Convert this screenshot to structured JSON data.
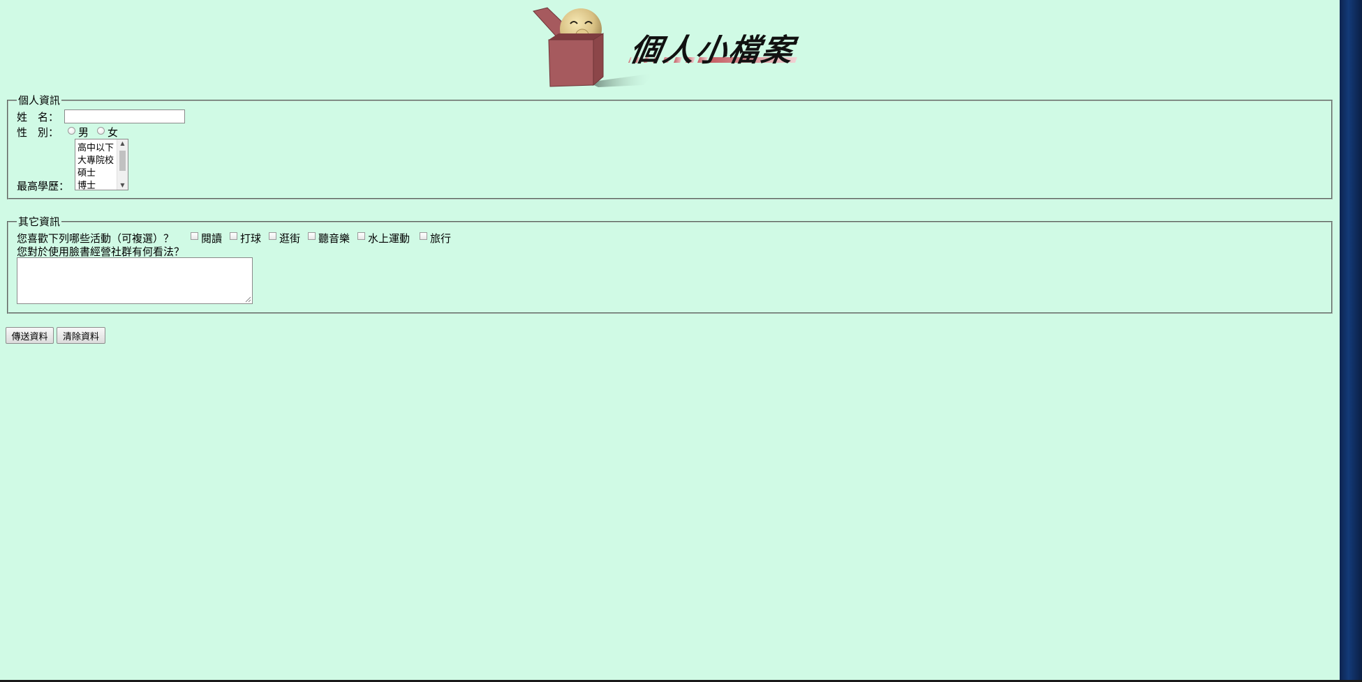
{
  "header": {
    "logo_title": "個人小檔案",
    "logo_icon": "box-with-face-logo"
  },
  "personal_info": {
    "legend": "個人資訊",
    "name_label": "姓　名：",
    "name_value": "",
    "gender_label": "性　別：",
    "gender_options": [
      "男",
      "女"
    ],
    "education_label": "最高學歷：",
    "education_options": [
      "高中以下",
      "大專院校",
      "碩士",
      "博士"
    ]
  },
  "other_info": {
    "legend": "其它資訊",
    "activities_question": "您喜歡下列哪些活動（可複選）？",
    "activities": [
      "閱讀",
      "打球",
      "逛街",
      "聽音樂",
      "水上運動",
      "旅行"
    ],
    "opinion_question": "您對於使用臉書經營社群有何看法？",
    "opinion_value": ""
  },
  "buttons": {
    "submit_label": "傳送資料",
    "reset_label": "清除資料"
  },
  "colors": {
    "page_background": "#d0fae5",
    "logo_box": "#a65a5e",
    "logo_stripe": "#c45c62"
  }
}
